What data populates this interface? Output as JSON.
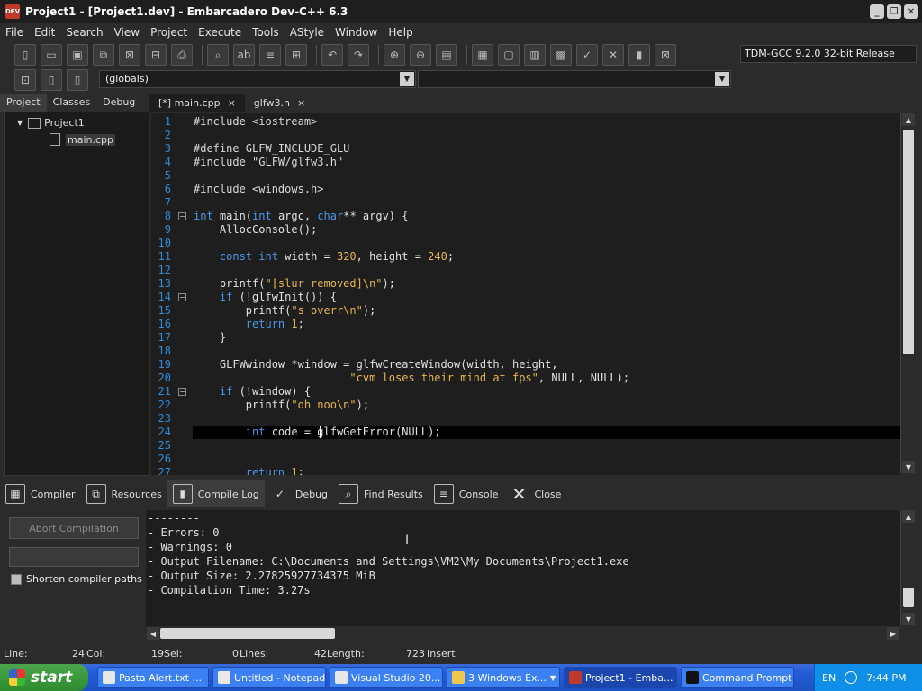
{
  "window": {
    "title": "Project1 - [Project1.dev] - Embarcadero Dev-C++ 6.3",
    "app_icon_text": "DEV"
  },
  "menu": [
    "File",
    "Edit",
    "Search",
    "View",
    "Project",
    "Execute",
    "Tools",
    "AStyle",
    "Window",
    "Help"
  ],
  "toolbar": {
    "compiler": "TDM-GCC 9.2.0 32-bit Release"
  },
  "toolbar2": {
    "scope": "(globals)",
    "member": ""
  },
  "left_panel": {
    "tabs": [
      "Project",
      "Classes",
      "Debug"
    ],
    "tree": {
      "project": "Project1",
      "file": "main.cpp"
    }
  },
  "editor_tabs": [
    {
      "label": "[*] main.cpp",
      "close": "×"
    },
    {
      "label": "glfw3.h",
      "close": "×"
    }
  ],
  "code": [
    {
      "n": "1",
      "t": "#include <iostream>"
    },
    {
      "n": "2",
      "t": ""
    },
    {
      "n": "3",
      "t": "#define GLFW_INCLUDE_GLU"
    },
    {
      "n": "4",
      "t": "#include \"GLFW/glfw3.h\""
    },
    {
      "n": "5",
      "t": ""
    },
    {
      "n": "6",
      "t": "#include <windows.h>"
    },
    {
      "n": "7",
      "t": ""
    },
    {
      "n": "8",
      "t": "int main(int argc, char** argv) {"
    },
    {
      "n": "9",
      "t": "    AllocConsole();"
    },
    {
      "n": "10",
      "t": ""
    },
    {
      "n": "11",
      "t": "    const int width = 320, height = 240;"
    },
    {
      "n": "12",
      "t": ""
    },
    {
      "n": "13",
      "t": "    printf(\"[slur removed]\\n\");"
    },
    {
      "n": "14",
      "t": "    if (!glfwInit()) {"
    },
    {
      "n": "15",
      "t": "        printf(\"s overr\\n\");"
    },
    {
      "n": "16",
      "t": "        return 1;"
    },
    {
      "n": "17",
      "t": "    }"
    },
    {
      "n": "18",
      "t": ""
    },
    {
      "n": "19",
      "t": "    GLFWwindow *window = glfwCreateWindow(width, height,"
    },
    {
      "n": "20",
      "t": "                        \"cvm loses their mind at fps\", NULL, NULL);"
    },
    {
      "n": "21",
      "t": "    if (!window) {"
    },
    {
      "n": "22",
      "t": "        printf(\"oh noo\\n\");"
    },
    {
      "n": "23",
      "t": ""
    },
    {
      "n": "24",
      "t": "        int code = glfwGetError(NULL);"
    },
    {
      "n": "25",
      "t": ""
    },
    {
      "n": "26",
      "t": ""
    },
    {
      "n": "27",
      "t": "        return 1;"
    }
  ],
  "bottom_tabs": [
    "Compiler",
    "Resources",
    "Compile Log",
    "Debug",
    "Find Results",
    "Console",
    "Close"
  ],
  "bottom_left": {
    "abort": "Abort Compilation",
    "shorten": "Shorten compiler paths"
  },
  "log": [
    "--------",
    "- Errors: 0",
    "- Warnings: 0",
    "- Output Filename: C:\\Documents and Settings\\VM2\\My Documents\\Project1.exe",
    "- Output Size: 2.27825927734375 MiB",
    "- Compilation Time: 3.27s"
  ],
  "status": {
    "line_label": "Line:",
    "line": "24",
    "col_label": "Col:",
    "col": "19",
    "sel_label": "Sel:",
    "sel": "0",
    "lines_label": "Lines:",
    "lines": "42",
    "length_label": "Length:",
    "length": "723",
    "mode": "Insert"
  },
  "taskbar": {
    "start": "start",
    "tasks": [
      {
        "label": "Pasta Alert.txt ..."
      },
      {
        "label": "Untitled - Notepad"
      },
      {
        "label": "Visual Studio 20..."
      },
      {
        "label": "3 Windows Ex..."
      },
      {
        "label": "Project1 - Emba..."
      },
      {
        "label": "Command Prompt"
      }
    ],
    "lang": "EN",
    "clock": "7:44 PM"
  }
}
